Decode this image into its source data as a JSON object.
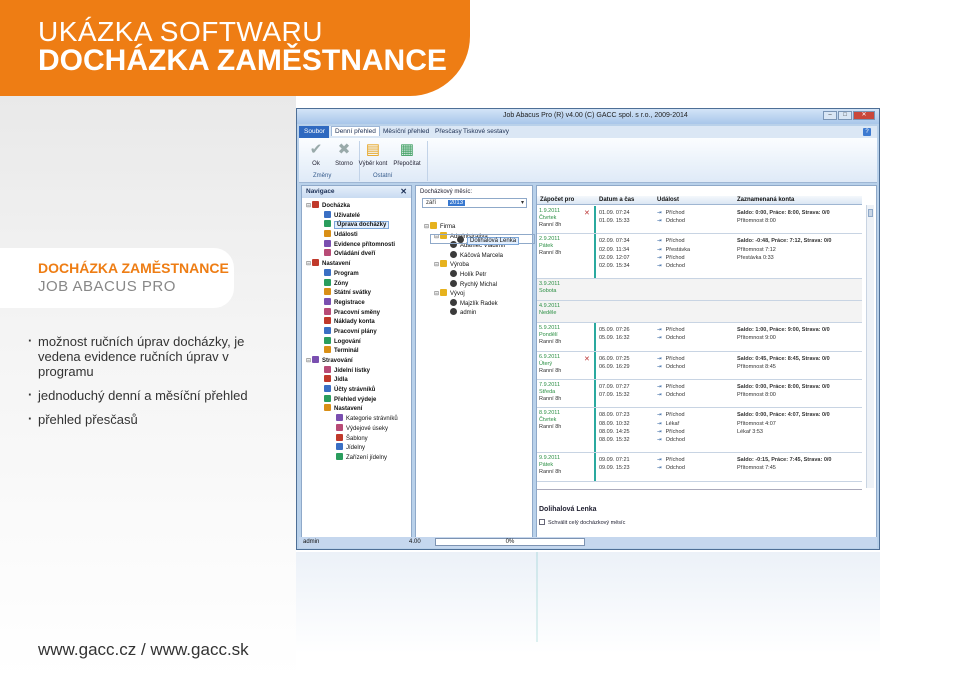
{
  "brochure": {
    "hero_line1": "UKÁZKA SOFTWARU",
    "hero_line2": "DOCHÁZKA ZAMĚSTNANCE",
    "card_title": "DOCHÁZKA ZAMĚSTNANCE",
    "card_subtitle": "JOB ABACUS PRO",
    "bullets": [
      "možnost ručních úprav docházky, je vedena evidence ručních úprav v programu",
      "jednoduchý denní a měsíční přehled",
      "přehled přesčasů"
    ],
    "url": "www.gacc.cz / www.gacc.sk",
    "accent_color": "#ee7d14"
  },
  "window": {
    "title": "Job Abacus Pro (R) v4.00 (C) GACC spol. s r.o., 2009-2014",
    "menu": [
      "Soubor",
      "Denní přehled",
      "Měsíční přehled",
      "Přesčasy",
      "Tiskové sestavy"
    ],
    "help_label": "?",
    "ribbon": {
      "ok": "Ok",
      "storno": "Storno",
      "vyber_kont": "Výběr kont",
      "prepocitat": "Přepočítat",
      "group_zmeny": "Změny",
      "group_ostatni": "Ostatní"
    }
  },
  "navigation": {
    "header": "Navigace",
    "close_glyph": "✕",
    "items": [
      {
        "label": "Docházka",
        "level": 0,
        "icon": "attendance-icon"
      },
      {
        "label": "Uživatelé",
        "level": 1,
        "icon": "users-icon"
      },
      {
        "label": "Úprava docházky",
        "level": 1,
        "icon": "edit-icon",
        "selected": true
      },
      {
        "label": "Události",
        "level": 1,
        "icon": "events-icon"
      },
      {
        "label": "Evidence přítomnosti",
        "level": 1,
        "icon": "check-icon"
      },
      {
        "label": "Ovládání dveří",
        "level": 1,
        "icon": "door-icon"
      },
      {
        "label": "Nastavení",
        "level": 0,
        "icon": "settings-icon"
      },
      {
        "label": "Program",
        "level": 1,
        "icon": "program-icon"
      },
      {
        "label": "Zóny",
        "level": 1,
        "icon": "zones-icon"
      },
      {
        "label": "Státní svátky",
        "level": 1,
        "icon": "holiday-icon"
      },
      {
        "label": "Registrace",
        "level": 1,
        "icon": "registration-icon"
      },
      {
        "label": "Pracovní směny",
        "level": 1,
        "icon": "shift-icon"
      },
      {
        "label": "Náklady konta",
        "level": 1,
        "icon": "cost-icon"
      },
      {
        "label": "Pracovní plány",
        "level": 1,
        "icon": "plan-icon"
      },
      {
        "label": "Logování",
        "level": 1,
        "icon": "log-icon"
      },
      {
        "label": "Terminál",
        "level": 1,
        "icon": "terminal-icon"
      },
      {
        "label": "Stravování",
        "level": 0,
        "icon": "food-icon"
      },
      {
        "label": "Jídelní lístky",
        "level": 1,
        "icon": "menu-icon"
      },
      {
        "label": "Jídla",
        "level": 1,
        "icon": "meal-icon"
      },
      {
        "label": "Účty strávníků",
        "level": 1,
        "icon": "account-icon"
      },
      {
        "label": "Přehled výdeje",
        "level": 1,
        "icon": "overview-icon"
      },
      {
        "label": "Nastavení",
        "level": 1,
        "icon": "settings-icon"
      },
      {
        "label": "Kategorie strávníků",
        "level": 2,
        "icon": "category-icon"
      },
      {
        "label": "Výdejové úseky",
        "level": 2,
        "icon": "section-icon"
      },
      {
        "label": "Šablony",
        "level": 2,
        "icon": "template-icon"
      },
      {
        "label": "Jídelny",
        "level": 2,
        "icon": "canteen-icon"
      },
      {
        "label": "Zařízení jídelny",
        "level": 2,
        "icon": "device-icon"
      }
    ]
  },
  "middle": {
    "label": "Docházkový měsíc:",
    "month": "září",
    "year": "2013",
    "tree": [
      {
        "label": "Firma",
        "level": 0,
        "type": "group"
      },
      {
        "label": "Administrativa",
        "level": 1,
        "type": "group"
      },
      {
        "label": "Adamec Vladimír",
        "level": 2,
        "type": "person"
      },
      {
        "label": "Káčová Marcela",
        "level": 2,
        "type": "person"
      },
      {
        "label": "Výroba",
        "level": 1,
        "type": "group"
      },
      {
        "label": "Dolihalová Lenka",
        "level": 2,
        "type": "person",
        "selected": true
      },
      {
        "label": "Holík Petr",
        "level": 2,
        "type": "person"
      },
      {
        "label": "Rychlý Michal",
        "level": 2,
        "type": "person"
      },
      {
        "label": "Vývoj",
        "level": 1,
        "type": "group"
      },
      {
        "label": "Majzlík Radek",
        "level": 2,
        "type": "person"
      },
      {
        "label": "admin",
        "level": 2,
        "type": "person"
      }
    ]
  },
  "grid": {
    "headers": [
      "Zápočet pro",
      "Datum a čas",
      "Událost",
      "Zaznamenaná konta"
    ],
    "days": [
      {
        "date": "1.9.2011",
        "weekday": "Čtvrtek",
        "shift": "Ranní 8h",
        "removed": true,
        "times": [
          "01.09. 07:24",
          "01.09. 15:33"
        ],
        "events": [
          "Příchod",
          "Odchod"
        ],
        "summary": "Saldo: 0:00, Práce: 8:00, Strava: 0/0",
        "accounts": [
          "Přítomnost 8:00"
        ]
      },
      {
        "date": "2.9.2011",
        "weekday": "Pátek",
        "shift": "Ranní 8h",
        "removed": false,
        "times": [
          "02.09. 07:34",
          "02.09. 11:34",
          "02.09. 12:07",
          "02.09. 15:34"
        ],
        "events": [
          "Příchod",
          "Přestávka",
          "Příchod",
          "Odchod"
        ],
        "summary": "Saldo: -0:48, Práce: 7:12, Strava: 0/0",
        "accounts": [
          "Přítomnost 7:12",
          "Přestávka 0:33"
        ]
      },
      {
        "date": "3.9.2011",
        "weekday": "Sobota",
        "shift": "",
        "weekend": true
      },
      {
        "date": "4.9.2011",
        "weekday": "Neděle",
        "shift": "",
        "weekend": true
      },
      {
        "date": "5.9.2011",
        "weekday": "Pondělí",
        "shift": "Ranní 8h",
        "removed": false,
        "times": [
          "05.09. 07:26",
          "05.09. 16:32"
        ],
        "events": [
          "Příchod",
          "Odchod"
        ],
        "summary": "Saldo: 1:00, Práce: 9:00, Strava: 0/0",
        "accounts": [
          "Přítomnost 9:00"
        ]
      },
      {
        "date": "6.9.2011",
        "weekday": "Úterý",
        "shift": "Ranní 8h",
        "removed": true,
        "times": [
          "06.09. 07:25",
          "06.09. 16:29"
        ],
        "events": [
          "Příchod",
          "Odchod"
        ],
        "summary": "Saldo: 0:45, Práce: 8:45, Strava: 0/0",
        "accounts": [
          "Přítomnost 8:45"
        ]
      },
      {
        "date": "7.9.2011",
        "weekday": "Středa",
        "shift": "Ranní 8h",
        "removed": false,
        "times": [
          "07.09. 07:27",
          "07.09. 15:32"
        ],
        "events": [
          "Příchod",
          "Odchod"
        ],
        "summary": "Saldo: 0:00, Práce: 8:00, Strava: 0/0",
        "accounts": [
          "Přítomnost 8:00"
        ]
      },
      {
        "date": "8.9.2011",
        "weekday": "Čtvrtek",
        "shift": "Ranní 8h",
        "removed": false,
        "times": [
          "08.09. 07:23",
          "08.09. 10:32",
          "08.09. 14:25",
          "08.09. 15:32"
        ],
        "events": [
          "Příchod",
          "Lékař",
          "Příchod",
          "Odchod"
        ],
        "summary": "Saldo: 0:00, Práce: 4:07, Strava: 0/0",
        "accounts": [
          "Přítomnost 4:07",
          "Lékař 3:53"
        ]
      },
      {
        "date": "9.9.2011",
        "weekday": "Pátek",
        "shift": "Ranní 8h",
        "removed": false,
        "times": [
          "09.09. 07:21",
          "09.09. 15:23"
        ],
        "events": [
          "Příchod",
          "Odchod"
        ],
        "summary": "Saldo: -0:15, Práce: 7:45, Strava: 0/0",
        "accounts": [
          "Přítomnost 7:45"
        ]
      }
    ],
    "employee_name": "Dolihalová Lenka",
    "checkbox_label": "Schválit celý docházkový měsíc"
  },
  "status": {
    "user": "admin",
    "version": "4.00",
    "progress_label": "0%",
    "progress": 0
  }
}
